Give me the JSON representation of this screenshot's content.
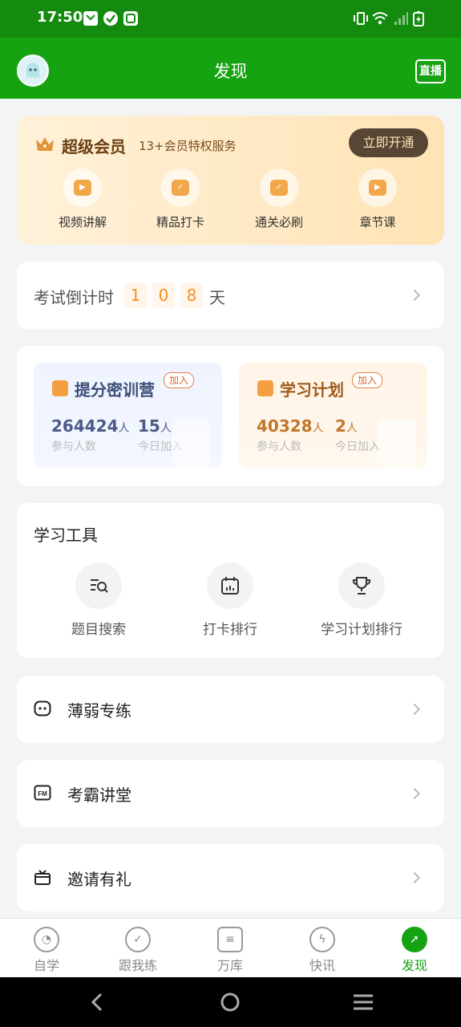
{
  "status_bar": {
    "time": "17:50"
  },
  "header": {
    "title": "发现",
    "live_label": "直播"
  },
  "vip": {
    "title": "超级会员",
    "subtitle": "13+会员特权服务",
    "button": "立即开通",
    "items": [
      {
        "label": "视频讲解",
        "icon": "video-icon"
      },
      {
        "label": "精品打卡",
        "icon": "calendar-check-icon"
      },
      {
        "label": "通关必刷",
        "icon": "clipboard-check-icon"
      },
      {
        "label": "章节课",
        "icon": "play-icon"
      }
    ]
  },
  "countdown": {
    "label": "考试倒计时",
    "digits": [
      "1",
      "0",
      "8"
    ],
    "unit": "天"
  },
  "camps": [
    {
      "title": "提分密训营",
      "badge": "加入",
      "count": "264424",
      "count_unit": "人",
      "count_label": "参与人数",
      "today": "15",
      "today_unit": "人",
      "today_label": "今日加入"
    },
    {
      "title": "学习计划",
      "badge": "加入",
      "count": "40328",
      "count_unit": "人",
      "count_label": "参与人数",
      "today": "2",
      "today_unit": "人",
      "today_label": "今日加入"
    }
  ],
  "tools": {
    "title": "学习工具",
    "items": [
      {
        "label": "题目搜索",
        "icon": "search-list-icon"
      },
      {
        "label": "打卡排行",
        "icon": "calendar-chart-icon"
      },
      {
        "label": "学习计划排行",
        "icon": "trophy-icon"
      }
    ]
  },
  "rows": [
    {
      "label": "薄弱专练",
      "icon": "robot-face-icon"
    },
    {
      "label": "考霸讲堂",
      "icon": "fm-radio-icon"
    },
    {
      "label": "邀请有礼",
      "icon": "gift-icon"
    }
  ],
  "tabs": [
    {
      "label": "自学",
      "icon": "self-study-icon"
    },
    {
      "label": "跟我练",
      "icon": "practice-icon"
    },
    {
      "label": "万库",
      "icon": "library-icon"
    },
    {
      "label": "快讯",
      "icon": "lightning-icon"
    },
    {
      "label": "发现",
      "icon": "compass-icon"
    }
  ],
  "colors": {
    "brand_green": "#16a312",
    "accent_orange": "#f29025"
  }
}
